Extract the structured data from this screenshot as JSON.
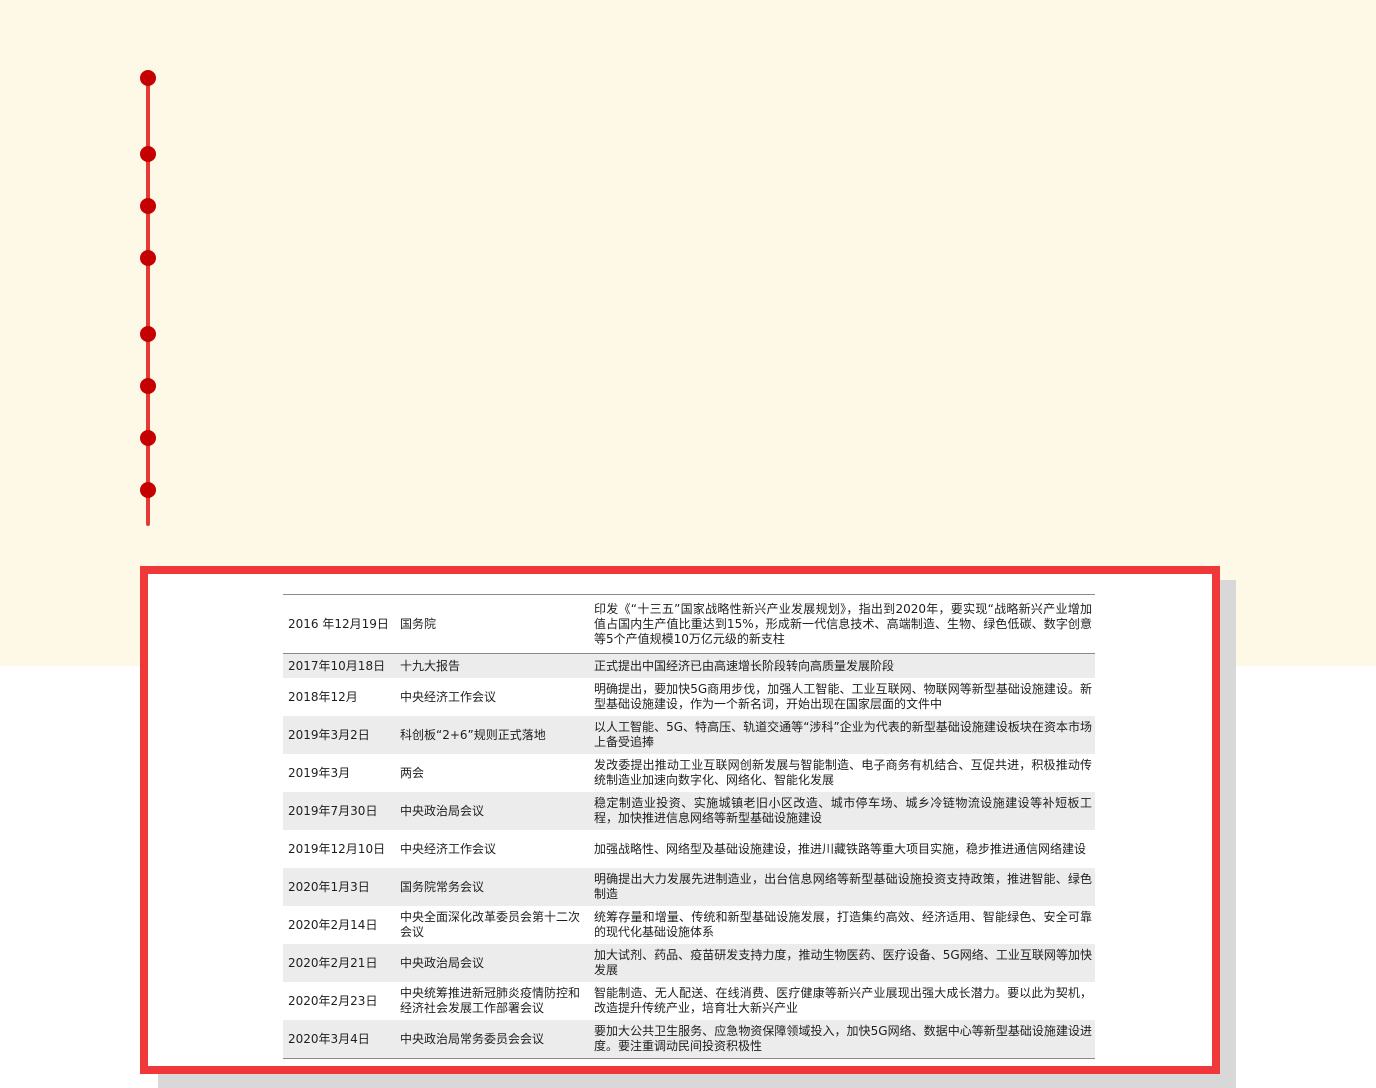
{
  "timeline": {
    "dot_count": 8
  },
  "table": {
    "rows": [
      {
        "date": "2016 年12月19日",
        "body": "国务院",
        "content": "印发《“十三五”国家战略性新兴产业发展规划》，指出到2020年，要实现“战略新兴产业增加值占国内生产值比重达到15%，形成新一代信息技术、高端制造、生物、绿色低碳、数字创意等5个产值规模10万亿元级的新支柱"
      },
      {
        "date": "2017年10月18日",
        "body": "十九大报告",
        "content": "正式提出中国经济已由高速增长阶段转向高质量发展阶段"
      },
      {
        "date": "2018年12月",
        "body": "中央经济工作会议",
        "content": "明确提出，要加快5G商用步伐，加强人工智能、工业互联网、物联网等新型基础设施建设。新型基础设施建设，作为一个新名词，开始出现在国家层面的文件中"
      },
      {
        "date": "2019年3月2日",
        "body": "科创板“2+6”规则正式落地",
        "content": "以人工智能、5G、特高压、轨道交通等“涉科”企业为代表的新型基础设施建设板块在资本市场上备受追捧"
      },
      {
        "date": "2019年3月",
        "body": "两会",
        "content": "发改委提出推动工业互联网创新发展与智能制造、电子商务有机结合、互促共进，积极推动传统制造业加速向数字化、网络化、智能化发展"
      },
      {
        "date": "2019年7月30日",
        "body": "中央政治局会议",
        "content": "稳定制造业投资、实施城镇老旧小区改造、城市停车场、城乡冷链物流设施建设等补短板工程，加快推进信息网络等新型基础设施建设"
      },
      {
        "date": "2019年12月10日",
        "body": "中央经济工作会议",
        "content": "加强战略性、网络型及基础设施建设，推进川藏铁路等重大项目实施，稳步推进通信网络建设"
      },
      {
        "date": "2020年1月3日",
        "body": "国务院常务会议",
        "content": "明确提出大力发展先进制造业，出台信息网络等新型基础设施投资支持政策，推进智能、绿色制造"
      },
      {
        "date": "2020年2月14日",
        "body": "中央全面深化改革委员会第十二次会议",
        "content": "统筹存量和增量、传统和新型基础设施发展，打造集约高效、经济适用、智能绿色、安全可靠的现代化基础设施体系"
      },
      {
        "date": "2020年2月21日",
        "body": "中央政治局会议",
        "content": "加大试剂、药品、疫苗研发支持力度，推动生物医药、医疗设备、5G网络、工业互联网等加快发展"
      },
      {
        "date": "2020年2月23日",
        "body": "中央统筹推进新冠肺炎疫情防控和经济社会发展工作部署会议",
        "content": "智能制造、无人配送、在线消费、医疗健康等新兴产业展现出强大成长潜力。要以此为契机，改造提升传统产业，培育壮大新兴产业"
      },
      {
        "date": "2020年3月4日",
        "body": "中央政治局常务委员会会议",
        "content": "要加大公共卫生服务、应急物资保障领域投入，加快5G网络、数据中心等新型基础设施建设进度。要注重调动民间投资积极性"
      }
    ]
  }
}
